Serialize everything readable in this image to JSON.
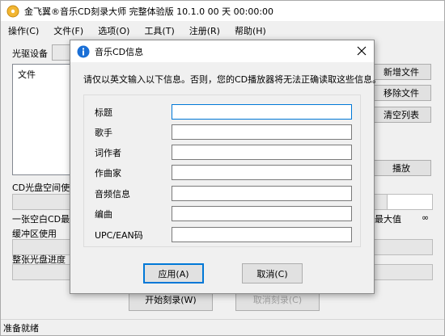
{
  "window": {
    "title": "金飞翼®音乐CD刻录大师 完整体验版 10.1.0 00 天 00:00:00"
  },
  "menu": [
    "操作(C)",
    "文件(F)",
    "选项(O)",
    "工具(T)",
    "注册(R)",
    "帮助(H)"
  ],
  "main": {
    "drive_label": "光驱设备",
    "list_header": "文件",
    "buttons": {
      "add": "新增文件",
      "remove": "移除文件",
      "clear": "清空列表",
      "play": "播放"
    },
    "cd_space_label": "CD光盘空间使用",
    "blank_cd_text": "一张空白CD最多",
    "max_label": "最大值",
    "infinity": "∞",
    "buffer_label": "缓冲区使用",
    "progress_label": "整张光盘进度",
    "burn_button": "开始刻录(W)",
    "cancel_burn_button": "取消刻录(C)"
  },
  "status": "准备就绪",
  "dialog": {
    "title": "音乐CD信息",
    "message": "请仅以英文输入以下信息。否则，您的CD播放器将无法正确读取这些信息。",
    "fields": [
      {
        "label": "标题",
        "value": ""
      },
      {
        "label": "歌手",
        "value": ""
      },
      {
        "label": "词作者",
        "value": ""
      },
      {
        "label": "作曲家",
        "value": ""
      },
      {
        "label": "音频信息",
        "value": ""
      },
      {
        "label": "编曲",
        "value": ""
      },
      {
        "label": "UPC/EAN码",
        "value": ""
      }
    ],
    "apply_button": "应用(A)",
    "cancel_button": "取消(C)"
  }
}
